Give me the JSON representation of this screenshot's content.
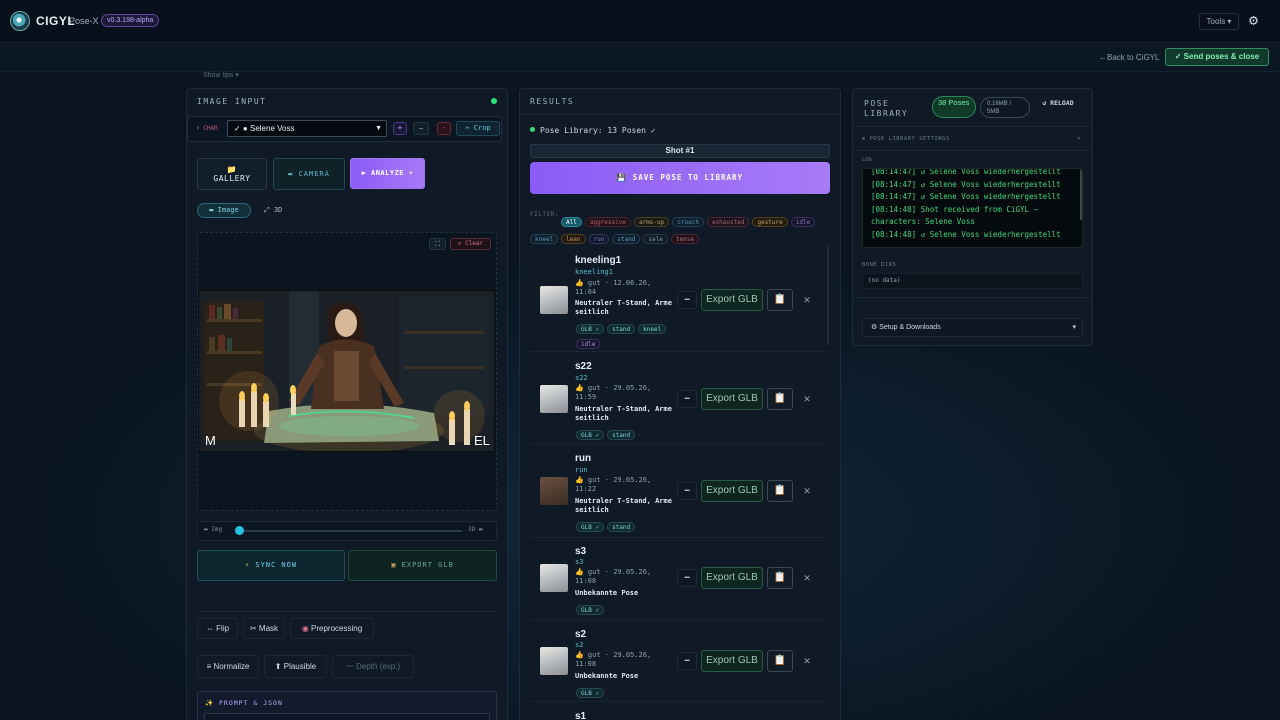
{
  "app": {
    "brand": "CIGYL",
    "product": "Pose-X",
    "version": "v0.3.198-alpha",
    "tools_label": "Tools ▾",
    "back_label": "←Back to CiGYL",
    "send_label": "✓ Send poses & close",
    "showtips": "Show tips ▾"
  },
  "left": {
    "title": "IMAGE INPUT",
    "char_label": "CHAR",
    "selected_character": "✓ ● Selene Voss",
    "plus": "+",
    "minus": "—",
    "remove": "-",
    "crop": "✂ Crop",
    "gallery": "GALLERY",
    "camera": "CAMERA",
    "analyze": "▶ ANALYZE ▾",
    "mode_image": "Image",
    "mode_3d": "3D",
    "clear": "✕ Clear",
    "corner_left": "M",
    "corner_right": "EL",
    "slider_left": "Img",
    "slider_right": "3D",
    "sync": "SYNC NOW",
    "export_glb": "EXPORT GLB",
    "flip": "Flip",
    "mask": "Mask",
    "preprocessing": "Preprocessing",
    "normalize": "Normalize",
    "plausible": "Plausible",
    "depth": "Depth (exp.)",
    "prompt_json": "PROMPT & JSON"
  },
  "results": {
    "title": "RESULTS",
    "library_status": "Pose Library: 13 Posen ✓",
    "shot_label": "Shot #1",
    "save_button": "SAVE POSE TO LIBRARY",
    "filter_label": "FILTER:",
    "filters_row1": [
      "All",
      "aggressive",
      "arms-up",
      "crouch",
      "exhausted",
      "gesture",
      "idle"
    ],
    "filters_row2": [
      "kneel",
      "lean",
      "run",
      "stand",
      "sale",
      "tense"
    ],
    "export_label": "Export GLB",
    "dash_label": "━",
    "poses": [
      {
        "name": "kneeling1",
        "sub": "kneeling1",
        "date": "👍 gut · 12.06.26, 11:04",
        "desc": "Neutraler T-Stand, Arme seitlich",
        "tags": [
          "GLB ✓",
          "stand",
          "kneel",
          "idle"
        ]
      },
      {
        "name": "s22",
        "sub": "s22",
        "date": "👍 gut · 29.05.26, 11:59",
        "desc": "Neutraler T-Stand, Arme seitlich",
        "tags": [
          "GLB ✓",
          "stand"
        ]
      },
      {
        "name": "run",
        "sub": "run",
        "date": "👍 gut · 29.05.26, 11:22",
        "desc": "Neutraler T-Stand, Arme seitlich",
        "tags": [
          "GLB ✓",
          "stand"
        ]
      },
      {
        "name": "s3",
        "sub": "s3",
        "date": "👍 gut · 29.05.26, 11:08",
        "desc": "Unbekannte Pose",
        "tags": [
          "GLB ✓"
        ]
      },
      {
        "name": "s2",
        "sub": "s2",
        "date": "👍 gut · 29.05.26, 11:08",
        "desc": "Unbekannte Pose",
        "tags": [
          "GLB ✓"
        ]
      },
      {
        "name": "s1"
      }
    ]
  },
  "library": {
    "title_line1": "POSE",
    "title_line2": "LIBRARY",
    "count_badge": "38 Poses",
    "size_badge": "0.16MB / 5MB",
    "reload": "↺ RELOAD",
    "settings": "POSE LIBRARY SETTINGS",
    "log_label": "LOG",
    "log": [
      "[08:14:47] ↺ Selene Voss wiederhergestellt",
      "[08:14:47] ↺ Selene Voss wiederhergestellt",
      "[08:14:47] ↺ Selene Voss wiederhergestellt",
      "[08:14:48] Shot received from CiGYL — characters: Selene Voss",
      "[08:14:48] ↺ Selene Voss wiederhergestellt"
    ],
    "bone_dirs_label": "BONE DIRS",
    "bone_dirs_value": "(no data)",
    "setup": "⚙ Setup & Downloads"
  }
}
